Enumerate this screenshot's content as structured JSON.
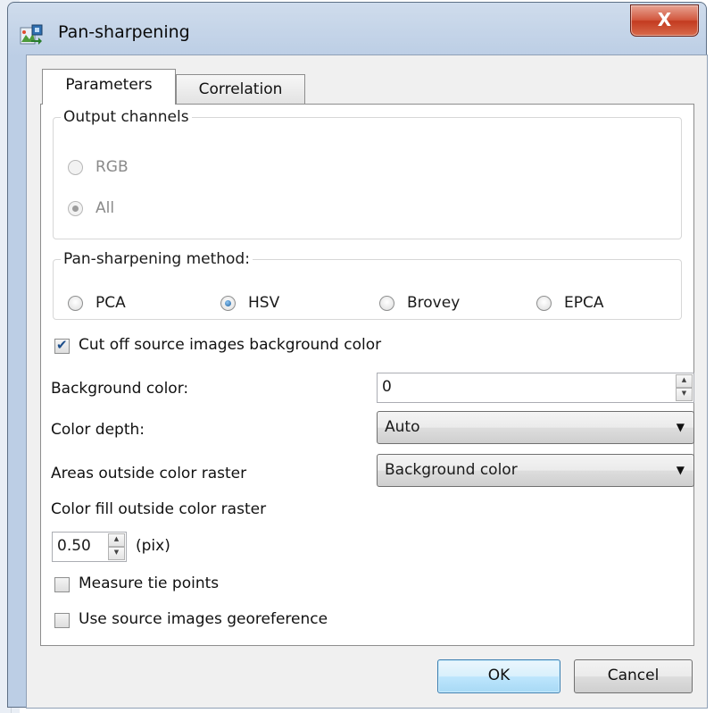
{
  "window": {
    "title": "Pan-sharpening",
    "close_label": "X"
  },
  "tabs": [
    {
      "label": "Parameters",
      "active": true
    },
    {
      "label": "Correlation",
      "active": false
    }
  ],
  "output_channels": {
    "legend": "Output channels",
    "options": [
      {
        "label": "RGB",
        "checked": false,
        "enabled": false
      },
      {
        "label": "All",
        "checked": true,
        "enabled": false
      }
    ]
  },
  "method": {
    "legend": "Pan-sharpening method:",
    "options": [
      {
        "label": "PCA",
        "checked": false
      },
      {
        "label": "HSV",
        "checked": true
      },
      {
        "label": "Brovey",
        "checked": false
      },
      {
        "label": "EPCA",
        "checked": false
      }
    ]
  },
  "cut_off_background": {
    "label": "Cut off source images background color",
    "checked": true
  },
  "background_color": {
    "label": "Background color:",
    "value": "0"
  },
  "color_depth": {
    "label": "Color depth:",
    "value": "Auto"
  },
  "areas_outside": {
    "label": "Areas outside color raster",
    "value": "Background color"
  },
  "color_fill": {
    "label": "Color fill outside color raster",
    "value": "0.50",
    "unit": "(pix)"
  },
  "measure_tie_points": {
    "label": "Measure tie points",
    "checked": false
  },
  "use_georeference": {
    "label": "Use source images georeference",
    "checked": false
  },
  "buttons": {
    "ok": "OK",
    "cancel": "Cancel"
  },
  "icons": {
    "app": "pan-sharpening-app-icon",
    "close": "close-icon",
    "spin_up": "▲",
    "spin_down": "▼",
    "dropdown": "▼"
  },
  "colors": {
    "title_bar": "#bccee5",
    "close_button": "#c33b20",
    "dialog_bg": "#f0f0f0",
    "default_button": "#bee6fd"
  }
}
